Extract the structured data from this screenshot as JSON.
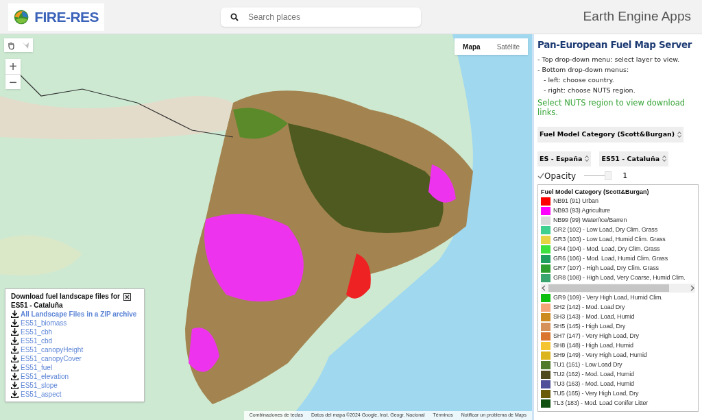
{
  "header": {
    "logo_text": "FIRE-RES",
    "search": {
      "placeholder": "Search places"
    },
    "brand": "Earth Engine Apps"
  },
  "map": {
    "kind": "picture",
    "map_types": [
      {
        "label": "Mapa",
        "selected": true
      },
      {
        "label": "Satélite",
        "selected": false
      }
    ],
    "zoom": [
      "+",
      "−"
    ],
    "download_panel": {
      "title": "Download fuel landscape files for ES51 - Cataluña",
      "links": [
        {
          "kind": "archive",
          "label": "All Landscape Files in a ZIP archive"
        },
        {
          "kind": "file",
          "label": "ES51_biomass"
        },
        {
          "kind": "file",
          "label": "ES51_cbh"
        },
        {
          "kind": "file",
          "label": "ES51_cbd"
        },
        {
          "kind": "file",
          "label": "ES51_canopyHeight"
        },
        {
          "kind": "file",
          "label": "ES51_canopyCover"
        },
        {
          "kind": "file",
          "label": "ES51_fuel"
        },
        {
          "kind": "file",
          "label": "ES51_elevation"
        },
        {
          "kind": "file",
          "label": "ES51_slope"
        },
        {
          "kind": "file",
          "label": "ES51_aspect"
        }
      ]
    },
    "attribution": [
      "Combinaciones de teclas",
      "Datos del mapa ©2024 Google, Inst. Geogr. Nacional",
      "Términos",
      "Notificar un problema de Maps"
    ]
  },
  "panel": {
    "title": "Pan-European Fuel Map Server",
    "instructions": [
      {
        "text": "- Top drop-down menu: select layer to view."
      },
      {
        "text": "- Bottom drop-down menus:",
        "children": [
          {
            "text": "- left: choose country."
          },
          {
            "text": "- right: choose NUTS region."
          }
        ]
      }
    ],
    "hint": "Select NUTS region to view download links.",
    "layer_select": "Fuel Model Category (Scott&Burgan)",
    "country_select": "ES - España",
    "region_select": "ES51 - Cataluña",
    "opacity": {
      "checked": true,
      "label": "Opacity",
      "level": 1,
      "value": "1"
    },
    "legend": {
      "title": "Fuel Model Category (Scott&Burgan)",
      "items": [
        {
          "color": "#ff0000",
          "label": "NB91 (91) Urban"
        },
        {
          "color": "#ff00ff",
          "label": "NB93 (93) Agriculture"
        },
        {
          "color": "#d9d9d9",
          "label": "NB99 (99) Water/Ice/Barren"
        },
        {
          "color": "#3fcf8e",
          "label": "GR2 (102) - Low Load, Dry Clim. Grass"
        },
        {
          "color": "#e6d442",
          "label": "GR3 (103) - Low Load, Humid Clim. Grass"
        },
        {
          "color": "#3ee23e",
          "label": "GR4 (104) - Mod. Load, Dry Clim. Grass"
        },
        {
          "color": "#1f9e5e",
          "label": "GR6 (106) - Mod. Load, Humid Clim. Grass"
        },
        {
          "color": "#2e9e2e",
          "label": "GR7 (107) - High Load, Dry Clim. Grass"
        },
        {
          "color": "#3aa56e",
          "label": "GR8 (108) - High Load, Very Coarse, Humid Clim."
        },
        {
          "color": "#0fbf0f",
          "label": "GR9 (109) - Very High Load, Humid Clim."
        },
        {
          "color": "#f4a578",
          "label": "SH2 (142) - Mod. Load Dry"
        },
        {
          "color": "#cd8a1e",
          "label": "SH3 (143) - Mod. Load, Humid"
        },
        {
          "color": "#d6915a",
          "label": "SH5 (145) - High Load, Dry"
        },
        {
          "color": "#d9752e",
          "label": "SH7 (147) - Very High Load, Dry"
        },
        {
          "color": "#f5c531",
          "label": "SH8 (148) - High Load, Humid"
        },
        {
          "color": "#dcb41c",
          "label": "SH9 (149) - Very High Load, Humid"
        },
        {
          "color": "#4f7a2a",
          "label": "TU1 (161) - Low Load Dry"
        },
        {
          "color": "#4f4a1e",
          "label": "TU2 (162) - Mod. Load, Humid"
        },
        {
          "color": "#4f4f9a",
          "label": "TU3 (163) - Mod. Load, Humid"
        },
        {
          "color": "#6a5a0a",
          "label": "TU5 (165) - Very High Load, Dry"
        },
        {
          "color": "#0f4f0f",
          "label": "TL3 (183) - Mod. Load Conifer Litter"
        }
      ]
    }
  }
}
